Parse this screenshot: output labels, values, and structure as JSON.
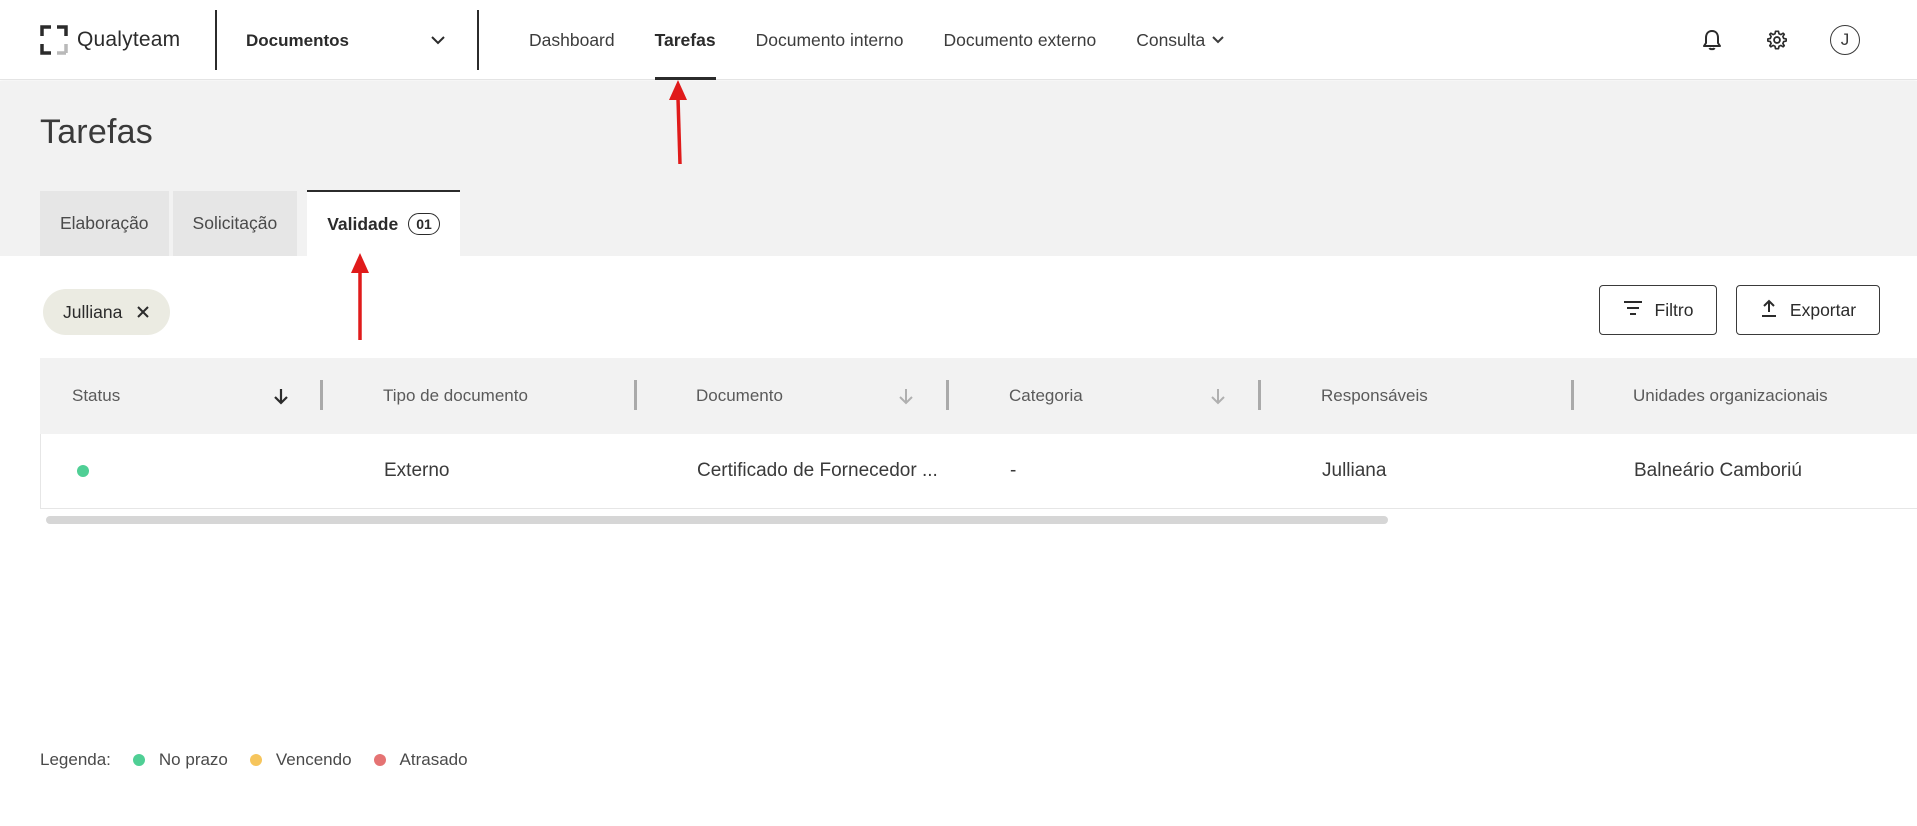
{
  "header": {
    "brand": "Qualyteam",
    "module": "Documentos",
    "nav": [
      {
        "label": "Dashboard",
        "active": false
      },
      {
        "label": "Tarefas",
        "active": true
      },
      {
        "label": "Documento interno",
        "active": false
      },
      {
        "label": "Documento externo",
        "active": false
      },
      {
        "label": "Consulta",
        "active": false,
        "has_dropdown": true
      }
    ],
    "icons": [
      "bell-icon",
      "gear-icon"
    ],
    "avatar_initial": "J"
  },
  "page": {
    "title": "Tarefas",
    "tabs": [
      {
        "label": "Elaboração",
        "active": false
      },
      {
        "label": "Solicitação",
        "active": false
      },
      {
        "label": "Validade",
        "active": true,
        "badge": "01"
      }
    ]
  },
  "filters": {
    "chip_label": "Julliana",
    "filter_button": "Filtro",
    "export_button": "Exportar"
  },
  "table": {
    "columns": [
      "Status",
      "Tipo de documento",
      "Documento",
      "Categoria",
      "Responsáveis",
      "Unidades organizacionais"
    ],
    "rows": [
      {
        "status": "No prazo",
        "tipo": "Externo",
        "documento": "Certificado de Fornecedor ...",
        "categoria": "-",
        "responsaveis": "Julliana",
        "unidades": "Balneário Camboriú"
      }
    ]
  },
  "legend": {
    "label": "Legenda:",
    "items": [
      {
        "label": "No prazo",
        "color": "#4fcf95"
      },
      {
        "label": "Vencendo",
        "color": "#f6c55c"
      },
      {
        "label": "Atrasado",
        "color": "#e57373"
      }
    ]
  },
  "colors": {
    "accent": "#2b2b2b",
    "page_bg": "#f2f2f2",
    "annotation_arrow": "#e01b1b"
  }
}
